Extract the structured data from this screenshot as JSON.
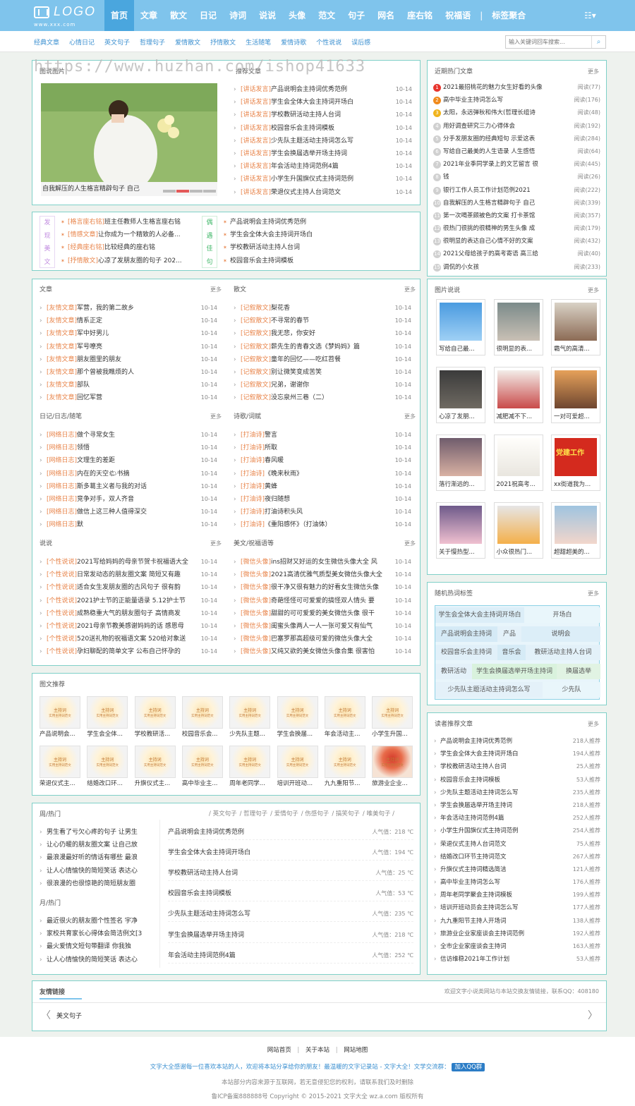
{
  "logo": {
    "text": "LOGO",
    "sub": "www.xxx.com"
  },
  "nav": {
    "items": [
      "首页",
      "文章",
      "散文",
      "日记",
      "诗词",
      "说说",
      "头像",
      "范文",
      "句子",
      "网名",
      "座右铭",
      "祝福语"
    ],
    "sep": "|",
    "extra": "标签聚合",
    "menu": "☷▾"
  },
  "subnav": [
    "经典文章",
    "心情日记",
    "英文句子",
    "哲理句子",
    "爱情散文",
    "抒情散文",
    "生活随笔",
    "爱情诗歌",
    "个性说说",
    "误后感"
  ],
  "search": {
    "placeholder": "输入关键词回车搜索..."
  },
  "watermark": "https://www.huzhan.com/ishop41633",
  "slider": {
    "title": "图说图片",
    "caption": "自我解压的人生格言精辟句子 自己"
  },
  "news": {
    "title": "推荐文章",
    "tag": "[讲话发言]",
    "items": [
      [
        "产品说明会主持词优秀范例",
        "10-14"
      ],
      [
        "学生会全体大会主持词开场白",
        "10-14"
      ],
      [
        "学校教研活动主持人台词",
        "10-14"
      ],
      [
        "校园音乐会主持词模板",
        "10-14"
      ],
      [
        "少先队主题活动主持词怎么写",
        "10-14"
      ],
      [
        "学生会换届选举开场主持词",
        "10-14"
      ],
      [
        "年会活动主持词范例4篇",
        "10-14"
      ],
      [
        "小学生升国旗仪式主持词范例",
        "10-14"
      ],
      [
        "荣退仪式主持人台词范文",
        "10-14"
      ]
    ]
  },
  "discover": {
    "left": [
      "发",
      "现",
      "美",
      "文"
    ],
    "right": [
      "偶",
      "遇",
      "佳",
      "句"
    ],
    "items": [
      [
        "[格言座右铭]",
        "班主任教师人生格言座右铭"
      ],
      [
        "[情感文章]",
        "让你成为一个精致的人必备..."
      ],
      [
        "[经典座右铭]",
        "比较经典的座右铭"
      ],
      [
        "[抒情散文]",
        "心凉了发朋友圈的句子 202..."
      ]
    ],
    "items2": [
      "产品说明会主持词优秀范例",
      "学生会全体大会主持词开场白",
      "学校教研活动主持人台词",
      "校园音乐会主持词模板"
    ]
  },
  "sections": [
    {
      "title": "文章",
      "more": "更多",
      "tag": "[友情文章]",
      "items": [
        "军营，我的第二故乡",
        "情系正定",
        "军中好男儿",
        "军号嘹亮",
        "朋友圈里的朋友",
        "那个曾被我瞧烦的人",
        "部队",
        "回忆军营"
      ]
    },
    {
      "title": "散文",
      "more": "更多",
      "tag": "[记叙散文]",
      "items": [
        "梨花香",
        "不寻常的春节",
        "我无悲，你安好",
        "薪先生的青春文选《梦妈妈》篇",
        "童年的回忆——吃红苕餐",
        "别让微笑变成苦笑",
        "兄弟，谢谢你",
        "没忘泉州三巷（二）"
      ]
    },
    {
      "title": "日记/日志/随笔",
      "more": "更多",
      "tag": "[网络日志]",
      "items": [
        "做个寻常女生",
        "领悟",
        "文理生的差距",
        "内在的天空🌤书摘",
        "斯多葛主义者与我的对话",
        "竞争对手，双人齐音",
        "做信上这三种人值得深交",
        "默"
      ]
    },
    {
      "title": "诗歌/词赋",
      "more": "更多",
      "tag": "[打油诗]",
      "items": [
        "警言",
        "所取",
        "春风暖",
        "《晚来秋雨》",
        "黄蜂",
        "夜归随想",
        "打油诗积头风",
        "《重阳感怀》（打油体）"
      ]
    },
    {
      "title": "说说",
      "more": "更多",
      "tag": "[个性说说]",
      "items": [
        "2021写给妈妈的母亲节贺卡祝福语大全",
        "日常发动态的朋友圈文案 简短又有趣",
        "适合女生发朋友圈的古风句子 很有韵",
        "2021护士节的正能量语录 5.12护士节",
        "成熟稳重大气的朋友圈句子 高情商发",
        "2021母亲节教美感谢妈妈的话 感恩母",
        "520送礼物的祝福语文案 520给对象送",
        "孕妇聊配的简单文字 公布自己怀孕的"
      ]
    },
    {
      "title": "美文/祝福语等",
      "more": "更多",
      "tag": "[微信头像]",
      "items": [
        "ins招财又好运的女生微信头像大全 风",
        "2021高清优雅气质型美女微信头像大全",
        "很干净又很有魅力的好看女生微信头像",
        "奇葩怪怪可可爱爱的搞怪双人情头 要",
        "甜甜的可可爱爱的美女微信头像 很干",
        "闺蜜头像两人一人一张可爱又有仙气",
        "巴塞罗那高超级可爱的微信头像大全",
        "又纯又欲的美女微信头像合集 很害怕"
      ]
    }
  ],
  "date": "10-14",
  "hot": {
    "title": "近期热门文章",
    "more": "更多",
    "items": [
      [
        "2021最招桃花的魅力女生好看的头像",
        "阅读(77)"
      ],
      [
        "高中毕业主持词怎么写",
        "阅读(176)"
      ],
      [
        "太阳，永远弹秋和伟大(哲理长组诗",
        "阅读(48)"
      ],
      [
        "用好调查研究三力心得体会",
        "阅读(192)"
      ],
      [
        "分手发朋友圈的经典短句 示爱这表",
        "阅读(284)"
      ],
      [
        "写给自己最美的人生语录 人生感悟",
        "阅读(64)"
      ],
      [
        "2021年业季同学录上的文艺留言 很",
        "阅读(445)"
      ],
      [
        "钱",
        "阅读(26)"
      ],
      [
        "银行工作人员工作计划范例2021",
        "阅读(222)"
      ],
      [
        "自我解压的人生格言精辟句子 自己",
        "阅读(339)"
      ],
      [
        "第一次喝茶颇被色的文案 打卡茶馆",
        "阅读(357)"
      ],
      [
        "很热门很挑的很精神的男生头像 成",
        "阅读(179)"
      ],
      [
        "很明显的表达自己心情不好的文案",
        "阅读(432)"
      ],
      [
        "2021父母给孩子的高考寄语 高三给",
        "阅读(40)"
      ],
      [
        "调侃的小女孩",
        "阅读(233)"
      ]
    ]
  },
  "shuoshuo": {
    "title": "图片说说",
    "more": "更多",
    "items": [
      "写给自己最...",
      "很明显的表...",
      "霸气的高清...",
      "心凉了发朋...",
      "减肥减不下...",
      "一对可爱超...",
      "落行渐远的...",
      "2021祝高考...",
      "xx街道我为...",
      "关于慢热型...",
      "小众很热门...",
      "超甜超美的..."
    ],
    "banner": "党建工作"
  },
  "tags": {
    "title": "随机热词标签",
    "more": "更多",
    "rows": [
      [
        "学生会全体大会主持词开场白",
        "开场白"
      ],
      [
        "产品说明会主持词",
        "产品",
        "说明会"
      ],
      [
        "校园音乐会主持词",
        "音乐会",
        "教研活动主持人台词"
      ],
      [
        "教研活动",
        "学生会换届选举开场主持词",
        "换届选举"
      ],
      [
        "少先队主题活动主持词怎么写",
        "少先队"
      ]
    ]
  },
  "pics": {
    "title": "图文推荐",
    "items": [
      "产品说明会...",
      "学生会全体...",
      "学校教研活...",
      "校园音乐会...",
      "少先队主题...",
      "学生会换届...",
      "年会活动主...",
      "小学生升国...",
      "荣退仪式主...",
      "结婚改口环...",
      "升旗仪式主...",
      "高中毕业主...",
      "周年老同学...",
      "培训开班动...",
      "九九重阳节...",
      "旅游业企业..."
    ],
    "thumbtext": "主持词",
    "thumbsub": "实用主持词范文"
  },
  "recommend": {
    "title": "读者推荐文章",
    "more": "更多",
    "items": [
      [
        "产品说明会主持词优秀范例",
        "218人推荐"
      ],
      [
        "学生会全体大会主持词开场白",
        "194人推荐"
      ],
      [
        "学校教研活动主持人台词",
        "25人推荐"
      ],
      [
        "校园音乐会主持词模板",
        "53人推荐"
      ],
      [
        "少先队主题活动主持词怎么写",
        "235人推荐"
      ],
      [
        "学生会换届选举开场主持词",
        "218人推荐"
      ],
      [
        "年会活动主持词范例4篇",
        "252人推荐"
      ],
      [
        "小学生升国旗仪式主持词范例",
        "254人推荐"
      ],
      [
        "荣退仪式主持人台词范文",
        "75人推荐"
      ],
      [
        "结婚改口环节主持词范文",
        "267人推荐"
      ],
      [
        "升旗仪式主持词精选简洁",
        "121人推荐"
      ],
      [
        "高中毕业主持词怎么写",
        "176人推荐"
      ],
      [
        "周年老同学聚会主持词模板",
        "199人推荐"
      ],
      [
        "培训开班动员会主持词怎么写",
        "177人推荐"
      ],
      [
        "九九重阳节主持人开场词",
        "138人推荐"
      ],
      [
        "旅游业企业家座谈会主持词范例",
        "192人推荐"
      ],
      [
        "全市企业家座谈会主持词",
        "163人推荐"
      ],
      [
        "信访维稳2021年工作计划",
        "53人推荐"
      ]
    ]
  },
  "weekly": {
    "title": "周/热门",
    "title2": "月/热门",
    "tabs": [
      "/ 英文句子",
      "/ 哲理句子",
      "/ 爱情句子",
      "/ 伤感句子",
      "/ 搞笑句子",
      "/ 唯美句子 /"
    ],
    "week": [
      "男生看了亏欠心疼的句子 让男生",
      "让心仍暖的朋友圈文案 让自己放",
      "最浪漫最好听的情话有哪些 最浪",
      "让人心情愉快的简短笑话 表达心",
      "很浪漫的也很惊艳的简短朋友圈"
    ],
    "month": [
      "最近很火的朋友圈个性签名 宇净",
      "家校共育家长心得体会简洁例文[3",
      "最火爱情文短句带翻译 你我独",
      "让人心情愉快的简短笑话 表达心"
    ],
    "mid": [
      [
        "产品说明会主持词优秀范例",
        "人气值：218 ℃"
      ],
      [
        "学生会全体大会主持词开场白",
        "人气值：194 ℃"
      ],
      [
        "学校教研活动主持人台词",
        "人气值：25 ℃"
      ],
      [
        "校园音乐会主持词模板",
        "人气值：53 ℃"
      ],
      [
        "少先队主题活动主持词怎么写",
        "人气值：235 ℃"
      ],
      [
        "学生会换届选举开场主持词",
        "人气值：218 ℃"
      ],
      [
        "年会活动主持词范例4篇",
        "人气值：252 ℃"
      ]
    ]
  },
  "links": {
    "title": "友情链接",
    "note": "欢迎文字小说类网站与本站交换友情链接，联系QQ：408180",
    "items": [
      "美文句子"
    ],
    "prev": "〈",
    "next": "〉"
  },
  "footer": {
    "nav": [
      "网站首页",
      "关于本站",
      "网站地图"
    ],
    "line1": "文字大全感谢每一位喜欢本站的人，欢迎将本站分享给你的朋友！最温暖的文字记录站 - 文字大全！文学交流群：",
    "qq": "加入QQ群",
    "line2": "本站部分内容来源于互联网，若无意侵犯您的权利，请联系我们及时删除",
    "line3": "鲁ICP备案888888号 Copyright © 2015-2021 文字大全 wz.a.com 版权所有"
  },
  "colors": {
    "header": "#7fc4ec",
    "active": "#4aa6de",
    "tag": "#e8844a",
    "border": "#7fd0c8"
  }
}
